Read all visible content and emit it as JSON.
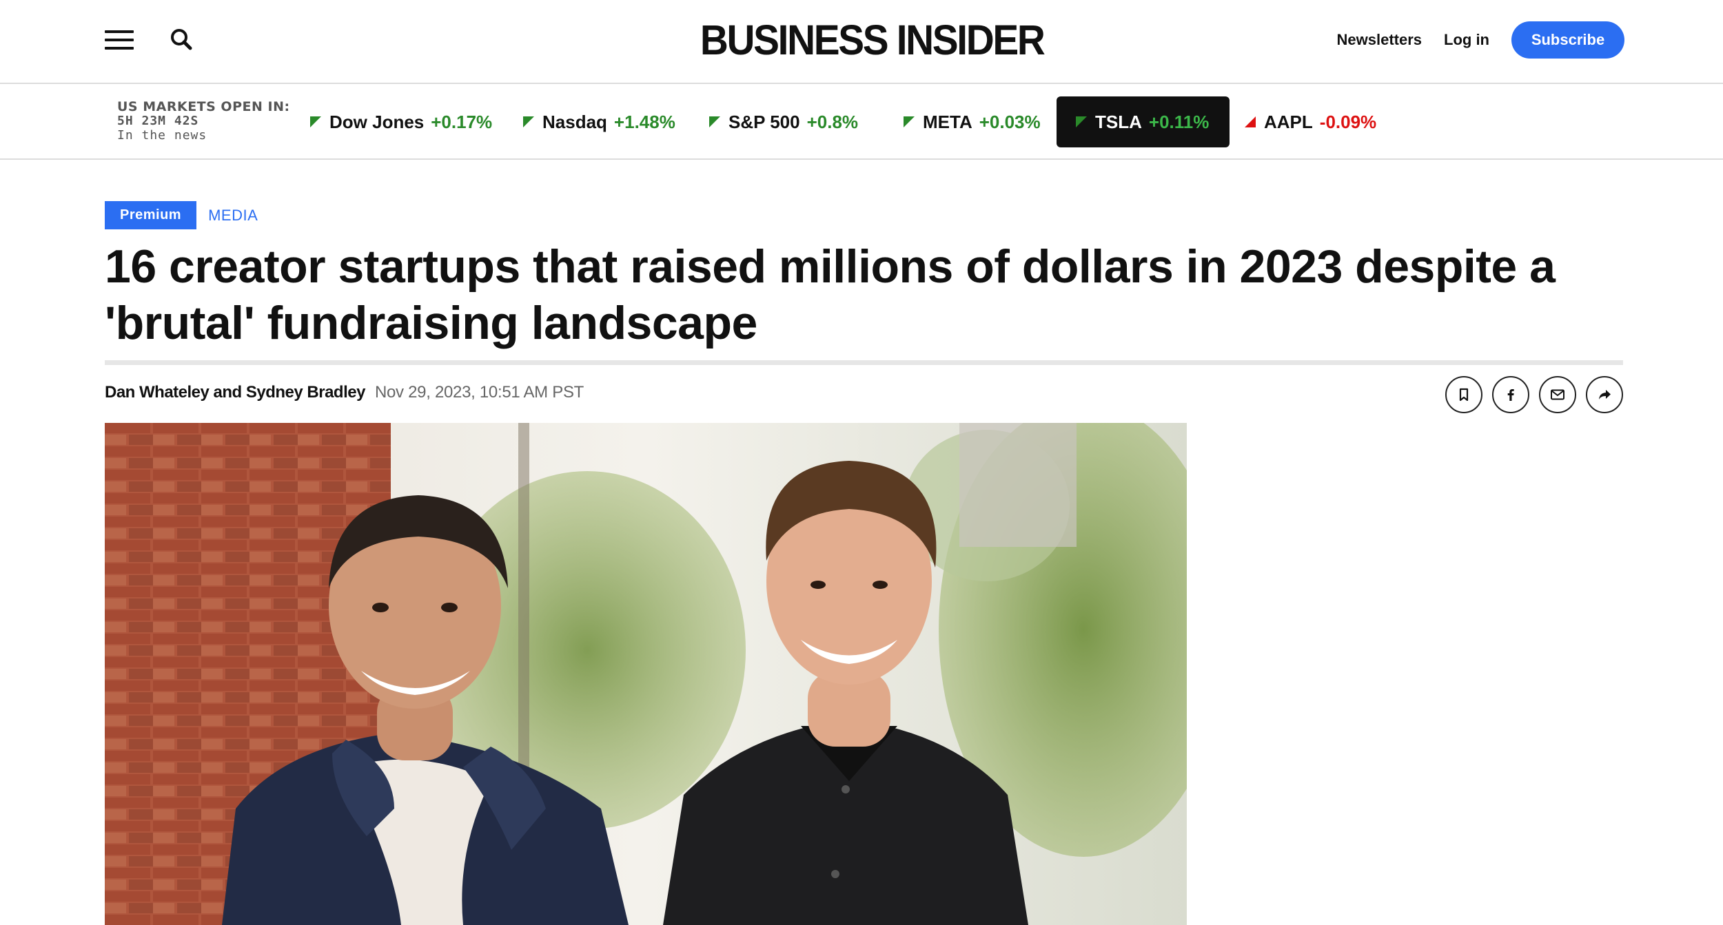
{
  "header": {
    "logo": "BUSINESS INSIDER",
    "newsletters_label": "Newsletters",
    "login_label": "Log in",
    "subscribe_label": "Subscribe",
    "menu_icon": "hamburger-menu-icon",
    "search_icon": "search-icon"
  },
  "markets": {
    "status_line1": "US MARKETS OPEN IN:",
    "countdown": "5H 23M 42S",
    "status_line3": "In the news",
    "tickers": [
      {
        "name": "Dow Jones",
        "change": "+0.17%",
        "direction": "up"
      },
      {
        "name": "Nasdaq",
        "change": "+1.48%",
        "direction": "up"
      },
      {
        "name": "S&P 500",
        "change": "+0.8%",
        "direction": "up"
      },
      {
        "name": "META",
        "change": "+0.03%",
        "direction": "up"
      },
      {
        "name": "TSLA",
        "change": "+0.11%",
        "direction": "up",
        "selected": true
      },
      {
        "name": "AAPL",
        "change": "-0.09%",
        "direction": "down"
      }
    ],
    "colors": {
      "up": "#2a8a2a",
      "down": "#dd1111"
    }
  },
  "article": {
    "badge": "Premium",
    "category": "MEDIA",
    "headline": "16 creator startups that raised millions of dollars in 2023 despite a 'brutal' fundraising landscape",
    "authors": "Dan Whateley and Sydney Bradley",
    "date": "Nov 29, 2023, 10:51 AM PST",
    "share_icons": [
      "bookmark-icon",
      "facebook-icon",
      "email-icon",
      "share-icon"
    ]
  },
  "colors": {
    "brand_blue": "#2b6ef2",
    "text": "#111111"
  }
}
